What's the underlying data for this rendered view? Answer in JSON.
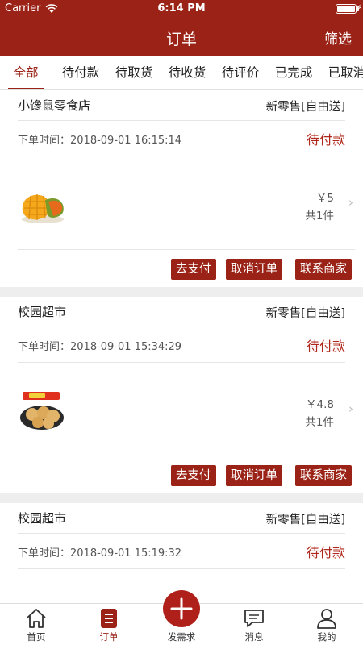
{
  "status_bar": {
    "carrier": "Carrier",
    "time": "6:14 PM"
  },
  "header": {
    "title": "订单",
    "filter_label": "筛选"
  },
  "tabs": [
    {
      "label": "全部",
      "active": true
    },
    {
      "label": "待付款"
    },
    {
      "label": "待取货"
    },
    {
      "label": "待收货"
    },
    {
      "label": "待评价"
    },
    {
      "label": "已完成"
    },
    {
      "label": "已取消"
    }
  ],
  "orders": [
    {
      "shop_name": "小馋鼠零食店",
      "delivery_type": "新零售[自由送]",
      "order_time": "下单时间：2018-09-01 16:15:14",
      "status": "待付款",
      "item_image": "mango-image",
      "price": "￥5",
      "quantity": "共1件",
      "actions": {
        "pay": "去支付",
        "cancel": "取消订单",
        "contact": "联系商家"
      }
    },
    {
      "shop_name": "校园超市",
      "delivery_type": "新零售[自由送]",
      "order_time": "下单时间：2018-09-01 15:34:29",
      "status": "待付款",
      "item_image": "biscuits-image",
      "price": "￥4.8",
      "quantity": "共1件",
      "actions": {
        "pay": "去支付",
        "cancel": "取消订单",
        "contact": "联系商家"
      }
    },
    {
      "shop_name": "校园超市",
      "delivery_type": "新零售[自由送]",
      "order_time": "下单时间：2018-09-01 15:19:32",
      "status": "待付款"
    }
  ],
  "bottom_nav": [
    {
      "label": "首页",
      "icon": "home-icon"
    },
    {
      "label": "订单",
      "icon": "order-icon",
      "active": true
    },
    {
      "label": "发需求",
      "icon": "plus-icon"
    },
    {
      "label": "消息",
      "icon": "message-icon"
    },
    {
      "label": "我的",
      "icon": "user-icon"
    }
  ],
  "colors": {
    "brand": "#9a2216",
    "status_text": "#b0281b",
    "background": "#eeeeee"
  }
}
